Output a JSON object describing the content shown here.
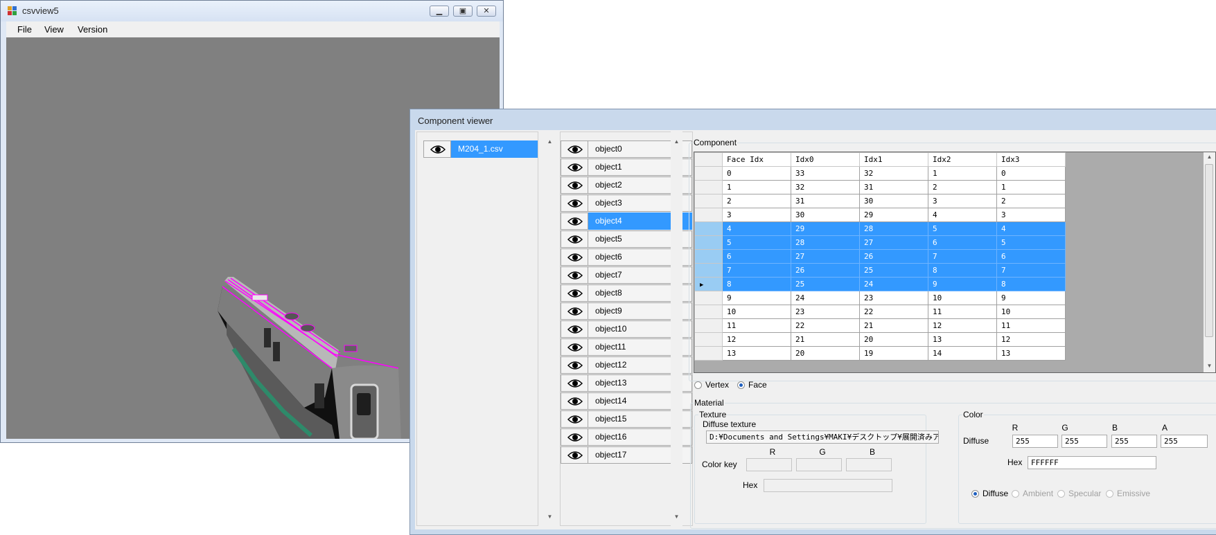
{
  "main_window": {
    "title": "csvview5",
    "menu": [
      "File",
      "View",
      "Version"
    ],
    "colors": {
      "viewport": "#808080",
      "highlight": "#ff00ff"
    }
  },
  "component_viewer": {
    "title": "Component viewer",
    "files": [
      {
        "name": "M204_1.csv",
        "selected": true
      }
    ],
    "objects": [
      "object0",
      "object1",
      "object2",
      "object3",
      "object4",
      "object5",
      "object6",
      "object7",
      "object8",
      "object9",
      "object10",
      "object11",
      "object12",
      "object13",
      "object14",
      "object15",
      "object16",
      "object17"
    ],
    "selected_object": "object4",
    "component": {
      "label": "Component",
      "columns": [
        "Face Idx",
        "Idx0",
        "Idx1",
        "Idx2",
        "Idx3"
      ],
      "rows": [
        [
          "0",
          "33",
          "32",
          "1",
          "0"
        ],
        [
          "1",
          "32",
          "31",
          "2",
          "1"
        ],
        [
          "2",
          "31",
          "30",
          "3",
          "2"
        ],
        [
          "3",
          "30",
          "29",
          "4",
          "3"
        ],
        [
          "4",
          "29",
          "28",
          "5",
          "4"
        ],
        [
          "5",
          "28",
          "27",
          "6",
          "5"
        ],
        [
          "6",
          "27",
          "26",
          "7",
          "6"
        ],
        [
          "7",
          "26",
          "25",
          "8",
          "7"
        ],
        [
          "8",
          "25",
          "24",
          "9",
          "8"
        ],
        [
          "9",
          "24",
          "23",
          "10",
          "9"
        ],
        [
          "10",
          "23",
          "22",
          "11",
          "10"
        ],
        [
          "11",
          "22",
          "21",
          "12",
          "11"
        ],
        [
          "12",
          "21",
          "20",
          "13",
          "12"
        ],
        [
          "13",
          "20",
          "19",
          "14",
          "13"
        ]
      ],
      "selected_rows": [
        4,
        5,
        6,
        7,
        8
      ],
      "current_row": 8
    },
    "mode": {
      "options": [
        "Vertex",
        "Face"
      ],
      "selected": "Face"
    },
    "material": {
      "label": "Material",
      "texture": {
        "label": "Texture",
        "diffuse_label": "Diffuse texture",
        "diffuse_path": "D:¥Documents and Settings¥MAKI¥デスクトップ¥展開済みアーカイブ",
        "color_key_label": "Color key",
        "rgb_headers": [
          "R",
          "G",
          "B"
        ],
        "hex_label": "Hex"
      },
      "color": {
        "label": "Color",
        "headers": [
          "R",
          "G",
          "B",
          "A"
        ],
        "diffuse_label": "Diffuse",
        "values": [
          "255",
          "255",
          "255",
          "255"
        ],
        "hex_label": "Hex",
        "hex_value": "FFFFFF",
        "options": [
          "Diffuse",
          "Ambient",
          "Specular",
          "Emissive"
        ],
        "selected": "Diffuse"
      }
    }
  }
}
